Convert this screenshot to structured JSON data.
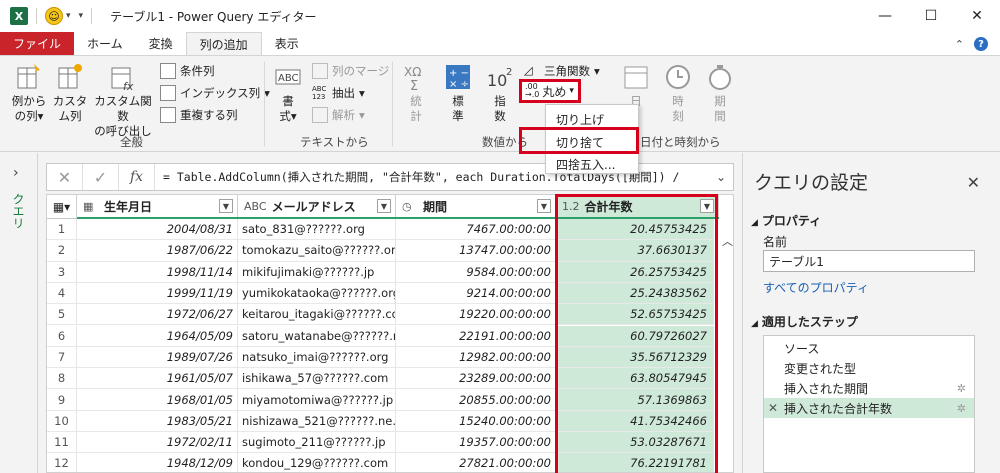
{
  "window": {
    "title": "テーブル1 - Power Query エディター",
    "app_icon": "X",
    "minimize": "—",
    "maximize": "☐",
    "close": "✕"
  },
  "tabs": [
    "ファイル",
    "ホーム",
    "変換",
    "列の追加",
    "表示"
  ],
  "active_tab": "列の追加",
  "ribbon": {
    "example_col": "例から\nの列",
    "custom_col": "カスタ\nム列",
    "invoke_custom": "カスタム関数\nの呼び出し",
    "conditional": "条件列",
    "index": "インデックス列",
    "duplicate": "重複する列",
    "group_general": "全般",
    "format": "書\n式",
    "merge": "列のマージ",
    "extract": "抽出",
    "parse": "解析",
    "group_text": "テキストから",
    "stats": "統\n計",
    "standard": "標\n準",
    "scientific": "指\n数",
    "trig": "三角関数",
    "round": "丸め",
    "group_number": "数値から",
    "date": "日",
    "time": "時\n刻",
    "duration": "期\n間",
    "group_datetime": "日付と時刻から"
  },
  "round_menu": [
    "切り上げ",
    "切り捨て",
    "四捨五入..."
  ],
  "query_pane_label": "クエリ",
  "formula": "= Table.AddColumn(挿入された期間, \"合計年数\", each Duration.TotalDays([期間]) /",
  "columns": [
    {
      "type": "▦",
      "name": "生年月日"
    },
    {
      "type": "ABC",
      "name": "メールアドレス"
    },
    {
      "type": "◷",
      "name": "期間"
    },
    {
      "type": "1.2",
      "name": "合計年数"
    }
  ],
  "rows": [
    [
      "1",
      "2004/08/31",
      "sato_831@??????.org",
      "7467.00:00:00",
      "20.45753425"
    ],
    [
      "2",
      "1987/06/22",
      "tomokazu_saito@??????.org",
      "13747.00:00:00",
      "37.6630137"
    ],
    [
      "3",
      "1998/11/14",
      "mikifujimaki@??????.jp",
      "9584.00:00:00",
      "26.25753425"
    ],
    [
      "4",
      "1999/11/19",
      "yumikokataoka@??????.org",
      "9214.00:00:00",
      "25.24383562"
    ],
    [
      "5",
      "1972/06/27",
      "keitarou_itagaki@??????.com",
      "19220.00:00:00",
      "52.65753425"
    ],
    [
      "6",
      "1964/05/09",
      "satoru_watanabe@??????.n...",
      "22191.00:00:00",
      "60.79726027"
    ],
    [
      "7",
      "1989/07/26",
      "natsuko_imai@??????.org",
      "12982.00:00:00",
      "35.56712329"
    ],
    [
      "8",
      "1961/05/07",
      "ishikawa_57@??????.com",
      "23289.00:00:00",
      "63.80547945"
    ],
    [
      "9",
      "1968/01/05",
      "miyamotomiwa@??????.jp",
      "20855.00:00:00",
      "57.1369863"
    ],
    [
      "10",
      "1983/05/21",
      "nishizawa_521@??????.ne.jp",
      "15240.00:00:00",
      "41.75342466"
    ],
    [
      "11",
      "1972/02/11",
      "sugimoto_211@??????.jp",
      "19357.00:00:00",
      "53.03287671"
    ],
    [
      "12",
      "1948/12/09",
      "kondou_129@??????.com",
      "27821.00:00:00",
      "76.22191781"
    ]
  ],
  "settings": {
    "title": "クエリの設定",
    "properties": "プロパティ",
    "name_label": "名前",
    "name_value": "テーブル1",
    "all_props": "すべてのプロパティ",
    "applied_steps": "適用したステップ",
    "steps": [
      "ソース",
      "変更された型",
      "挿入された期間",
      "挿入された合計年数"
    ]
  },
  "colors": {
    "file_tab": "#c8242a",
    "highlight": "#d6001c",
    "selected_col": "#cfe9d9",
    "accent_green": "#2aa06a"
  }
}
